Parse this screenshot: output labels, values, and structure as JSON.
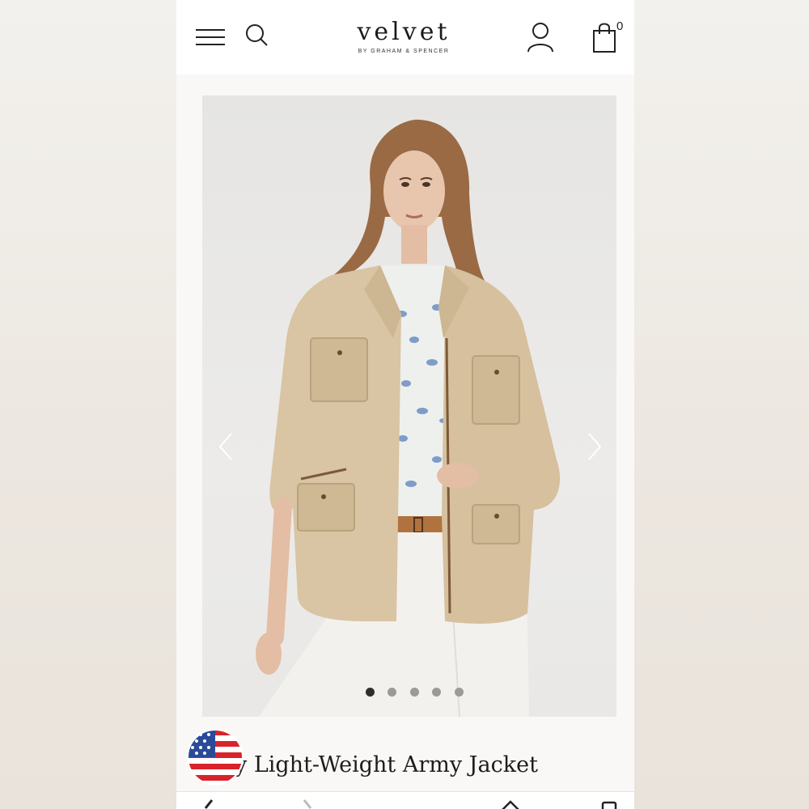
{
  "header": {
    "menu_icon": "hamburger-menu-icon",
    "search_icon": "search-icon",
    "logo_word": "velvet",
    "logo_tagline": "BY GRAHAM & SPENCER",
    "account_icon": "user-account-icon",
    "cart_icon": "shopping-bag-icon",
    "cart_count": "0"
  },
  "gallery": {
    "image_count": 5,
    "active_index": 0,
    "prev_icon": "chevron-left-icon",
    "next_icon": "chevron-right-icon"
  },
  "product": {
    "title": "y Light-Weight Army Jacket",
    "flag_icon": "us-flag-icon"
  },
  "bottom_nav": {
    "icons": [
      "back-icon",
      "forward-icon",
      "home-icon",
      "tabs-icon"
    ]
  },
  "colors": {
    "page_bg": "#f9f8f6",
    "jacket": "#d9c4a3",
    "shirt": "#eef0ee",
    "pants": "#f3f1ee"
  }
}
